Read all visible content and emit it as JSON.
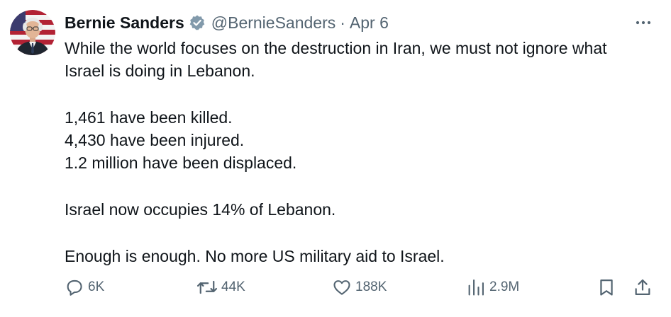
{
  "author": {
    "display_name": "Bernie Sanders",
    "handle": "@BernieSanders",
    "separator": "·",
    "date": "Apr 6",
    "verified": true,
    "verified_color": "#829aab"
  },
  "tweet": {
    "lines": [
      "While the world focuses on the destruction in Iran, we must not ignore what",
      "Israel is doing in Lebanon.",
      "1,461 have been killed.",
      "4,430 have been injured.",
      "1.2 million have been displaced.",
      "Israel now occupies 14% of Lebanon.",
      "Enough is enough. No more US military aid to Israel."
    ]
  },
  "actions": {
    "replies": "6K",
    "reposts": "44K",
    "likes": "188K",
    "views": "2.9M"
  },
  "icons": {
    "more": "more-horizontal-icon",
    "reply": "reply-bubble-icon",
    "repost": "repost-icon",
    "like": "heart-icon",
    "views": "analytics-bars-icon",
    "bookmark": "bookmark-icon",
    "share": "share-icon",
    "verified": "verified-badge-icon"
  },
  "colors": {
    "text_primary": "#0f1419",
    "text_secondary": "#536471"
  }
}
